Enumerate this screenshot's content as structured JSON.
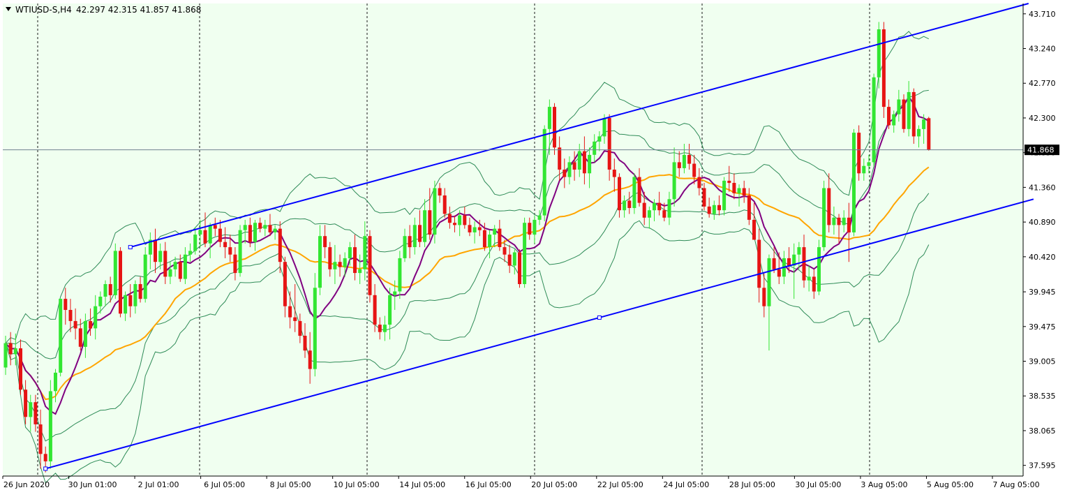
{
  "header": {
    "symbol_timeframe": "WTIUSD-S,H4",
    "ohlc": "42.297 42.315 41.857 41.868"
  },
  "current_price_label": "41.868",
  "colors": {
    "background": "#f0fff0",
    "grid": "#1a1a1a",
    "bull": "#32e632",
    "bear": "#e61414",
    "wick_bull": "#32e632",
    "wick_bear": "#e61414",
    "ma_fast": "#800080",
    "ma_slow": "#ffa500",
    "bollinger": "#2e8b57",
    "channel": "#0000ff",
    "price_line": "#708090"
  },
  "chart_data": {
    "type": "candlestick",
    "y_axis": {
      "ticks": [
        "43.710",
        "43.240",
        "42.770",
        "42.300",
        "41.830",
        "41.360",
        "40.890",
        "40.420",
        "39.945",
        "39.475",
        "39.005",
        "38.535",
        "38.065",
        "37.595"
      ],
      "range": [
        37.45,
        43.85
      ]
    },
    "x_axis": {
      "tick_labels": [
        "26 Jun 2020",
        "30 Jun 01:00",
        "2 Jul 01:00",
        "6 Jul 05:00",
        "8 Jul 05:00",
        "10 Jul 05:00",
        "14 Jul 05:00",
        "16 Jul 05:00",
        "20 Jul 05:00",
        "22 Jul 05:00",
        "24 Jul 05:00",
        "28 Jul 05:00",
        "30 Jul 05:00",
        "3 Aug 05:00",
        "5 Aug 05:00",
        "7 Aug 05:00"
      ],
      "separator_labels": [
        "30 Jun 01:00",
        "6 Jul 05:00",
        "10 Jul 05:00",
        "16 Jul 05:00",
        "22 Jul 05:00",
        "28 Jul 05:00",
        "3 Aug 05:00"
      ]
    },
    "current_price": 41.868,
    "ohlc": [
      [
        38.92,
        39.35,
        38.82,
        39.25
      ],
      [
        39.25,
        39.4,
        38.95,
        39.1
      ],
      [
        39.1,
        39.38,
        38.95,
        39.18
      ],
      [
        39.18,
        39.3,
        38.55,
        38.62
      ],
      [
        38.62,
        38.75,
        38.15,
        38.25
      ],
      [
        38.25,
        38.55,
        38.05,
        38.45
      ],
      [
        38.45,
        38.55,
        38.05,
        38.15
      ],
      [
        38.15,
        38.35,
        37.55,
        37.75
      ],
      [
        37.75,
        37.85,
        37.5,
        37.65
      ],
      [
        37.65,
        38.75,
        37.55,
        38.6
      ],
      [
        38.6,
        38.9,
        38.45,
        38.85
      ],
      [
        38.85,
        39.85,
        38.8,
        39.85
      ],
      [
        39.85,
        40.0,
        39.5,
        39.7
      ],
      [
        39.7,
        39.85,
        39.4,
        39.55
      ],
      [
        39.55,
        39.72,
        39.3,
        39.45
      ],
      [
        39.45,
        39.58,
        39.15,
        39.2
      ],
      [
        39.2,
        39.65,
        39.05,
        39.55
      ],
      [
        39.55,
        39.72,
        39.35,
        39.45
      ],
      [
        39.45,
        39.9,
        39.3,
        39.75
      ],
      [
        39.75,
        39.95,
        39.65,
        39.88
      ],
      [
        39.88,
        40.1,
        39.75,
        40.05
      ],
      [
        40.05,
        40.15,
        39.8,
        39.9
      ],
      [
        39.9,
        40.6,
        39.85,
        40.5
      ],
      [
        40.5,
        40.55,
        39.6,
        39.65
      ],
      [
        39.65,
        39.95,
        39.55,
        39.9
      ],
      [
        39.9,
        40.05,
        39.6,
        39.75
      ],
      [
        39.75,
        40.1,
        39.65,
        40.05
      ],
      [
        40.05,
        40.15,
        39.8,
        39.85
      ],
      [
        39.85,
        40.55,
        39.8,
        40.45
      ],
      [
        40.45,
        40.75,
        40.25,
        40.65
      ],
      [
        40.65,
        40.8,
        40.2,
        40.35
      ],
      [
        40.35,
        40.6,
        40.25,
        40.5
      ],
      [
        40.5,
        40.62,
        40.05,
        40.15
      ],
      [
        40.15,
        40.35,
        40.05,
        40.25
      ],
      [
        40.25,
        40.42,
        40.15,
        40.35
      ],
      [
        40.35,
        40.45,
        40.08,
        40.12
      ],
      [
        40.12,
        40.55,
        40.05,
        40.45
      ],
      [
        40.45,
        40.6,
        40.35,
        40.5
      ],
      [
        40.5,
        40.82,
        40.45,
        40.72
      ],
      [
        40.72,
        40.92,
        40.55,
        40.78
      ],
      [
        40.78,
        41.02,
        40.55,
        40.6
      ],
      [
        40.6,
        40.88,
        40.4,
        40.85
      ],
      [
        40.85,
        40.95,
        40.7,
        40.8
      ],
      [
        40.8,
        40.92,
        40.55,
        40.62
      ],
      [
        40.62,
        40.82,
        40.4,
        40.55
      ],
      [
        40.55,
        40.72,
        40.35,
        40.45
      ],
      [
        40.45,
        40.55,
        40.1,
        40.2
      ],
      [
        40.2,
        40.85,
        40.15,
        40.78
      ],
      [
        40.78,
        40.92,
        40.6,
        40.85
      ],
      [
        40.85,
        40.95,
        40.55,
        40.62
      ],
      [
        40.62,
        40.92,
        40.5,
        40.88
      ],
      [
        40.88,
        40.95,
        40.75,
        40.8
      ],
      [
        40.8,
        40.92,
        40.7,
        40.85
      ],
      [
        40.85,
        41.0,
        40.7,
        40.75
      ],
      [
        40.75,
        40.85,
        40.65,
        40.8
      ],
      [
        40.8,
        40.9,
        40.2,
        40.35
      ],
      [
        40.35,
        40.42,
        39.6,
        39.75
      ],
      [
        39.75,
        39.95,
        39.45,
        39.6
      ],
      [
        39.6,
        40.05,
        39.4,
        39.55
      ],
      [
        39.55,
        39.65,
        39.25,
        39.35
      ],
      [
        39.35,
        39.52,
        39.05,
        39.15
      ],
      [
        39.15,
        39.4,
        38.7,
        38.9
      ],
      [
        38.9,
        40.2,
        38.8,
        40.0
      ],
      [
        40.0,
        40.85,
        39.9,
        40.7
      ],
      [
        40.7,
        40.85,
        40.4,
        40.55
      ],
      [
        40.55,
        40.62,
        40.15,
        40.25
      ],
      [
        40.25,
        40.58,
        40.05,
        40.35
      ],
      [
        40.35,
        40.45,
        40.15,
        40.28
      ],
      [
        40.28,
        40.48,
        40.15,
        40.4
      ],
      [
        40.4,
        40.62,
        40.3,
        40.55
      ],
      [
        40.55,
        40.72,
        40.1,
        40.2
      ],
      [
        40.2,
        40.45,
        40.05,
        40.25
      ],
      [
        40.25,
        40.9,
        40.1,
        40.7
      ],
      [
        40.7,
        40.78,
        39.8,
        39.9
      ],
      [
        39.9,
        40.05,
        39.4,
        39.5
      ],
      [
        39.5,
        39.6,
        39.3,
        39.4
      ],
      [
        39.4,
        39.62,
        39.28,
        39.5
      ],
      [
        39.5,
        40.0,
        39.3,
        39.9
      ],
      [
        39.9,
        40.1,
        39.7,
        39.95
      ],
      [
        39.95,
        40.5,
        39.85,
        40.4
      ],
      [
        40.4,
        40.8,
        40.35,
        40.7
      ],
      [
        40.7,
        40.85,
        40.4,
        40.55
      ],
      [
        40.55,
        40.95,
        40.45,
        40.85
      ],
      [
        40.85,
        41.05,
        40.55,
        40.62
      ],
      [
        40.62,
        41.2,
        40.55,
        41.05
      ],
      [
        41.05,
        41.35,
        40.65,
        40.72
      ],
      [
        40.72,
        41.45,
        40.6,
        41.35
      ],
      [
        41.35,
        41.42,
        41.15,
        41.25
      ],
      [
        41.25,
        41.35,
        40.95,
        41.0
      ],
      [
        41.0,
        41.1,
        40.8,
        40.88
      ],
      [
        40.88,
        40.98,
        40.75,
        40.85
      ],
      [
        40.85,
        41.05,
        40.7,
        40.98
      ],
      [
        40.98,
        41.1,
        40.8,
        40.85
      ],
      [
        40.85,
        40.95,
        40.7,
        40.75
      ],
      [
        40.75,
        40.9,
        40.6,
        40.82
      ],
      [
        40.82,
        40.92,
        40.7,
        40.78
      ],
      [
        40.78,
        40.88,
        40.5,
        40.55
      ],
      [
        40.55,
        40.78,
        40.4,
        40.72
      ],
      [
        40.72,
        40.85,
        40.55,
        40.8
      ],
      [
        40.8,
        40.92,
        40.5,
        40.55
      ],
      [
        40.55,
        40.65,
        40.35,
        40.45
      ],
      [
        40.45,
        40.58,
        40.2,
        40.3
      ],
      [
        40.3,
        40.52,
        40.18,
        40.48
      ],
      [
        40.48,
        40.52,
        40.0,
        40.05
      ],
      [
        40.05,
        40.95,
        40.0,
        40.88
      ],
      [
        40.88,
        40.95,
        40.65,
        40.72
      ],
      [
        40.72,
        40.98,
        40.6,
        40.92
      ],
      [
        40.92,
        41.05,
        40.85,
        40.98
      ],
      [
        40.98,
        42.2,
        40.9,
        42.15
      ],
      [
        42.15,
        42.55,
        41.8,
        42.45
      ],
      [
        42.45,
        42.5,
        41.8,
        41.9
      ],
      [
        41.9,
        42.05,
        41.45,
        41.6
      ],
      [
        41.6,
        41.75,
        41.35,
        41.5
      ],
      [
        41.5,
        41.78,
        41.4,
        41.7
      ],
      [
        41.7,
        41.85,
        41.45,
        41.6
      ],
      [
        41.6,
        41.95,
        41.5,
        41.85
      ],
      [
        41.85,
        42.05,
        41.4,
        41.55
      ],
      [
        41.55,
        41.9,
        41.35,
        41.8
      ],
      [
        41.8,
        42.08,
        41.7,
        41.98
      ],
      [
        41.98,
        42.12,
        41.85,
        42.05
      ],
      [
        42.05,
        42.35,
        41.95,
        42.3
      ],
      [
        42.3,
        42.35,
        41.45,
        41.6
      ],
      [
        41.6,
        41.75,
        41.3,
        41.5
      ],
      [
        41.5,
        41.55,
        40.95,
        41.05
      ],
      [
        41.05,
        41.25,
        40.95,
        41.18
      ],
      [
        41.18,
        41.3,
        41.0,
        41.08
      ],
      [
        41.08,
        41.55,
        41.0,
        41.5
      ],
      [
        41.5,
        41.62,
        41.1,
        41.15
      ],
      [
        41.15,
        41.3,
        40.85,
        40.95
      ],
      [
        40.95,
        41.1,
        40.8,
        41.05
      ],
      [
        41.05,
        41.2,
        40.9,
        41.15
      ],
      [
        41.15,
        41.3,
        40.98,
        41.05
      ],
      [
        41.05,
        41.15,
        40.9,
        40.95
      ],
      [
        40.95,
        41.3,
        40.85,
        41.2
      ],
      [
        41.2,
        41.9,
        41.1,
        41.7
      ],
      [
        41.7,
        41.85,
        41.5,
        41.62
      ],
      [
        41.62,
        41.95,
        41.55,
        41.8
      ],
      [
        41.8,
        41.95,
        41.6,
        41.68
      ],
      [
        41.68,
        41.8,
        41.4,
        41.5
      ],
      [
        41.5,
        41.62,
        41.25,
        41.35
      ],
      [
        41.35,
        41.42,
        41.05,
        41.1
      ],
      [
        41.1,
        41.22,
        40.95,
        41.0
      ],
      [
        41.0,
        41.18,
        40.92,
        41.12
      ],
      [
        41.12,
        41.25,
        40.98,
        41.05
      ],
      [
        41.05,
        41.5,
        40.98,
        41.45
      ],
      [
        41.45,
        41.65,
        41.3,
        41.42
      ],
      [
        41.42,
        41.55,
        41.2,
        41.28
      ],
      [
        41.28,
        41.4,
        41.1,
        41.35
      ],
      [
        41.35,
        41.45,
        41.15,
        41.25
      ],
      [
        41.25,
        41.35,
        40.85,
        40.92
      ],
      [
        40.92,
        41.15,
        40.75,
        40.65
      ],
      [
        40.65,
        40.8,
        39.8,
        40.0
      ],
      [
        40.0,
        40.2,
        39.6,
        39.75
      ],
      [
        39.75,
        40.45,
        39.15,
        40.4
      ],
      [
        40.4,
        40.55,
        40.2,
        40.25
      ],
      [
        40.25,
        40.48,
        40.05,
        40.15
      ],
      [
        40.15,
        40.5,
        40.05,
        40.4
      ],
      [
        40.4,
        40.55,
        40.2,
        40.3
      ],
      [
        40.3,
        40.6,
        39.85,
        40.45
      ],
      [
        40.45,
        40.62,
        40.25,
        40.55
      ],
      [
        40.55,
        40.72,
        40.0,
        40.1
      ],
      [
        40.1,
        40.3,
        39.95,
        40.15
      ],
      [
        40.15,
        40.25,
        39.85,
        39.95
      ],
      [
        39.95,
        40.65,
        39.9,
        40.55
      ],
      [
        40.55,
        41.45,
        40.5,
        41.35
      ],
      [
        41.35,
        41.55,
        40.75,
        40.85
      ],
      [
        40.85,
        41.1,
        40.72,
        40.95
      ],
      [
        40.95,
        41.0,
        40.6,
        40.85
      ],
      [
        40.85,
        41.05,
        40.75,
        40.95
      ],
      [
        40.95,
        41.15,
        40.35,
        40.75
      ],
      [
        40.75,
        42.15,
        40.7,
        42.1
      ],
      [
        42.1,
        42.2,
        41.45,
        41.55
      ],
      [
        41.55,
        41.75,
        41.45,
        41.65
      ],
      [
        41.65,
        41.8,
        41.55,
        41.7
      ],
      [
        41.7,
        42.9,
        41.65,
        42.85
      ],
      [
        42.85,
        43.6,
        42.7,
        43.5
      ],
      [
        43.5,
        43.6,
        42.3,
        42.45
      ],
      [
        42.45,
        42.55,
        42.15,
        42.2
      ],
      [
        42.2,
        42.4,
        42.1,
        42.35
      ],
      [
        42.35,
        42.68,
        42.25,
        42.55
      ],
      [
        42.55,
        42.62,
        42.1,
        42.15
      ],
      [
        42.15,
        42.8,
        42.05,
        42.65
      ],
      [
        42.65,
        42.7,
        41.95,
        42.05
      ],
      [
        42.05,
        42.2,
        41.9,
        42.15
      ],
      [
        42.15,
        42.35,
        41.95,
        42.28
      ],
      [
        42.297,
        42.315,
        41.857,
        41.868
      ]
    ],
    "channel_upper": {
      "start": {
        "t": 25,
        "p": 40.55
      },
      "end": {
        "t": 205,
        "p": 43.85
      }
    },
    "channel_lower": {
      "start": {
        "t": 8,
        "p": 37.55
      },
      "end": {
        "t": 206,
        "p": 41.2
      }
    }
  }
}
